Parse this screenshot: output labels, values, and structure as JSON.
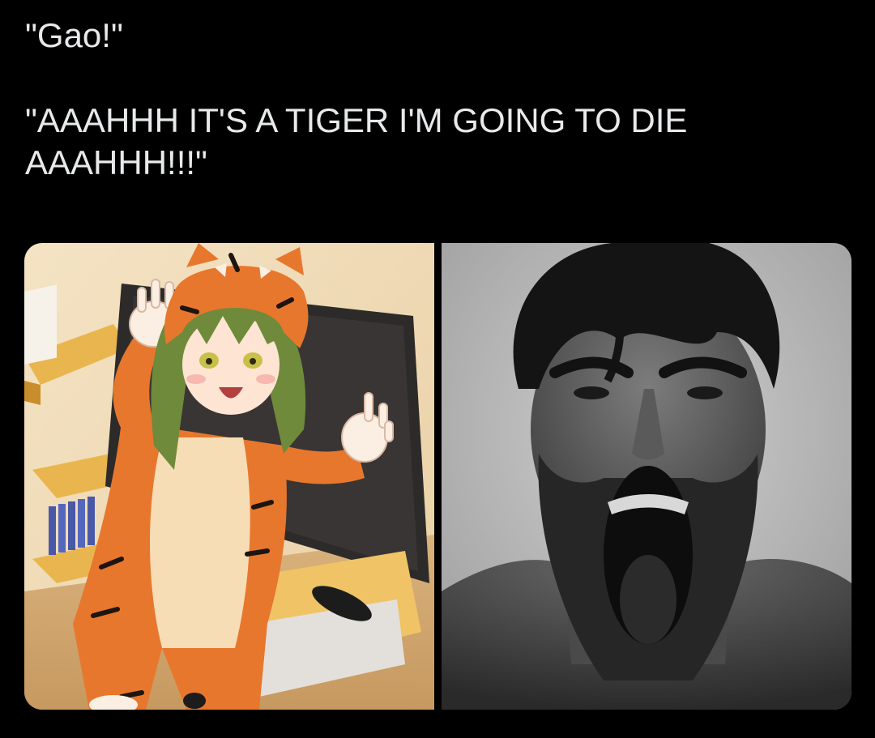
{
  "post": {
    "line_1": "\"Gao!\"",
    "line_2": "\"AAAHHH IT'S A TIGER I'M GOING TO DIE",
    "line_3": "AAAHHH!!!\""
  },
  "media": {
    "count": 2,
    "items": [
      {
        "kind": "illustration",
        "subject": "green-haired anime girl in orange tiger onesie doing a claw pose"
      },
      {
        "kind": "photo",
        "subject": "black-and-white photo of bearded man screaming"
      }
    ]
  },
  "colors": {
    "background": "#000000",
    "text": "#e7e9ea",
    "tiger_orange": "#e8772e",
    "hair_green": "#6f8a3a"
  }
}
